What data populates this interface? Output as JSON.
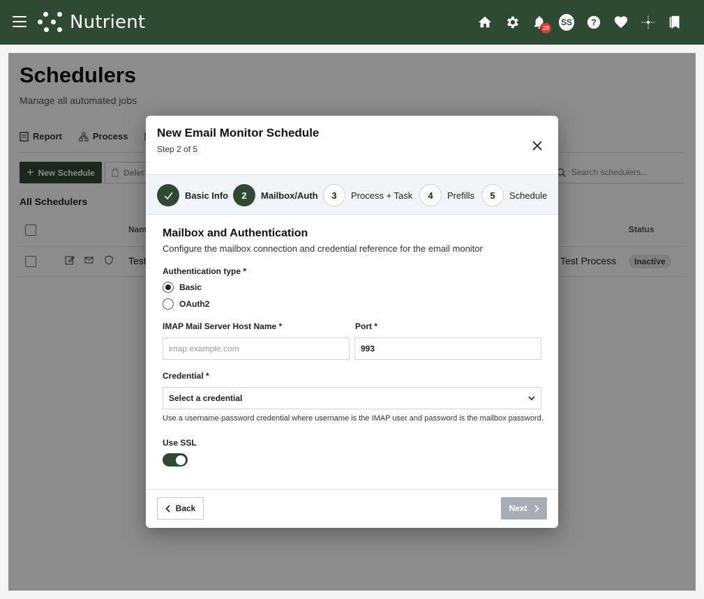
{
  "app": {
    "name": "Nutrient",
    "notification_count": "28",
    "user_initials": "SS"
  },
  "top_icons": [
    "home-icon",
    "gear-icon",
    "bell-icon",
    "avatar",
    "help-icon",
    "heart-icon",
    "sparkle-icon",
    "bookmarks-icon"
  ],
  "page": {
    "title": "Schedulers",
    "subtitle": "Manage all automated jobs",
    "tabs": [
      {
        "label": "Report",
        "icon": "report-icon"
      },
      {
        "label": "Process",
        "icon": "process-icon"
      },
      {
        "label": "",
        "icon": "email-icon"
      }
    ],
    "new_button": "New Schedule",
    "delete_button": "Delet",
    "search_placeholder": "Search schedulers...",
    "section_label": "All Schedulers",
    "columns": {
      "name": "Nam",
      "status": "Status"
    },
    "rows": [
      {
        "name": "Test",
        "process": "Test Process",
        "status": "Inactive"
      }
    ]
  },
  "modal": {
    "title": "New Email Monitor Schedule",
    "step_text": "Step 2 of 5",
    "steps": [
      {
        "number": "1",
        "label": "Basic Info",
        "state": "done"
      },
      {
        "number": "2",
        "label": "Mailbox/Auth",
        "state": "active"
      },
      {
        "number": "3",
        "label": "Process + Task",
        "state": "todo"
      },
      {
        "number": "4",
        "label": "Prefills",
        "state": "todo"
      },
      {
        "number": "5",
        "label": "Schedule",
        "state": "todo"
      }
    ],
    "section_title": "Mailbox and Authentication",
    "section_desc": "Configure the mailbox connection and credential reference for the email monitor",
    "auth_label": "Authentication type *",
    "auth_options": [
      {
        "label": "Basic",
        "selected": true
      },
      {
        "label": "OAuth2",
        "selected": false
      }
    ],
    "host_label": "IMAP Mail Server Host Name *",
    "host_placeholder": "imap.example.com",
    "host_value": "",
    "port_label": "Port *",
    "port_value": "993",
    "credential_label": "Credential *",
    "credential_value": "Select a credential",
    "credential_hint": "Use a username-password credential where username is the IMAP user and password is the mailbox password.",
    "ssl_label": "Use SSL",
    "ssl_enabled": true,
    "back_label": "Back",
    "next_label": "Next"
  },
  "colors": {
    "brand": "#2e4a32",
    "badge": "#e53935",
    "disabled": "#a7adb4"
  }
}
